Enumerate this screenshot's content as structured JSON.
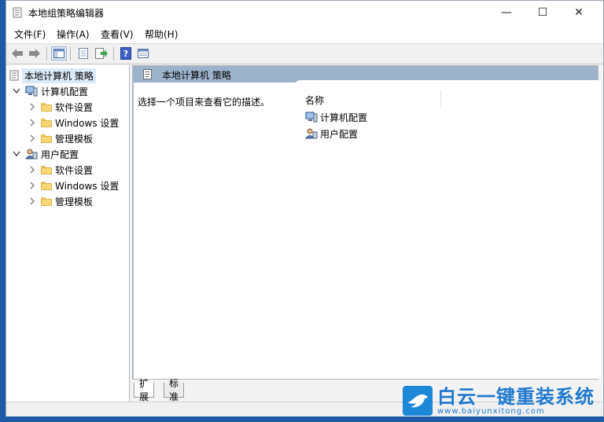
{
  "window": {
    "title": "本地组策略编辑器",
    "controls": {
      "minimize": "—",
      "maximize": "☐",
      "close": "✕"
    }
  },
  "menu": [
    "文件(F)",
    "操作(A)",
    "查看(V)",
    "帮助(H)"
  ],
  "tree": {
    "root": "本地计算机 策略",
    "computer_config": "计算机配置",
    "user_config": "用户配置",
    "computer_children": [
      "软件设置",
      "Windows 设置",
      "管理模板"
    ],
    "user_children": [
      "软件设置",
      "Windows 设置",
      "管理模板"
    ]
  },
  "right_pane": {
    "header_title": "本地计算机 策略",
    "description": "选择一个项目来查看它的描述。",
    "column_name": "名称",
    "items": [
      "计算机配置",
      "用户配置"
    ]
  },
  "tabs": [
    "扩展",
    "标准"
  ],
  "watermark": {
    "text": "白云一键重装系统",
    "url": "www.baiyunxitong.com"
  },
  "colors": {
    "header_bar": "#9db3cc",
    "selection": "#dce9f8",
    "folder": "#f7d774",
    "help_icon": "#3b5ec6",
    "watermark": "#1e79cf"
  },
  "icons": {
    "back": "arrow-left-icon",
    "forward": "arrow-right-icon",
    "show_tree": "show-hide-tree-icon",
    "properties": "properties-icon",
    "export": "export-list-icon",
    "help": "help-icon",
    "view": "view-pane-icon"
  }
}
